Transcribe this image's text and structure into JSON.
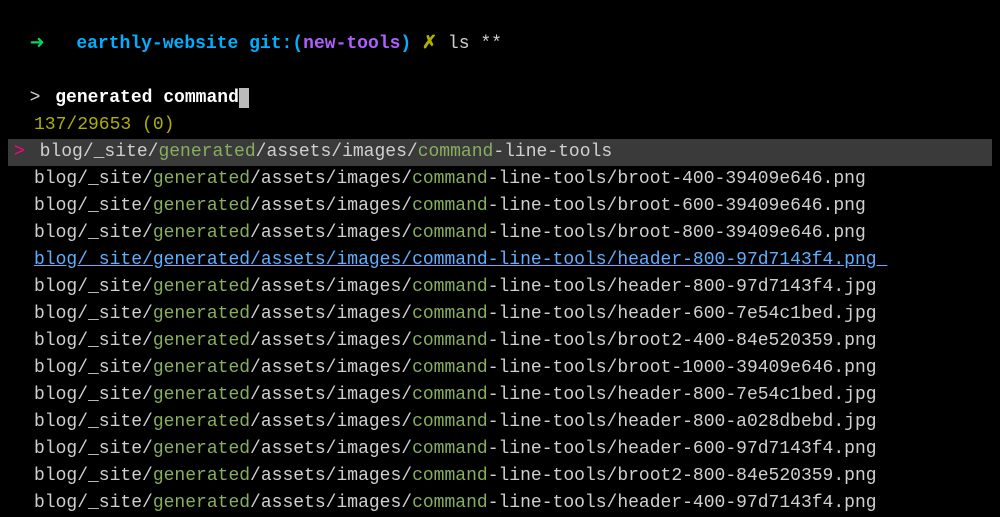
{
  "prompt": {
    "arrow": "➜",
    "dir": "earthly-website",
    "git_label": "git:(",
    "branch": "new-tools",
    "git_close": ")",
    "symbol": "✗",
    "command": "ls **"
  },
  "query": {
    "arrow": ">",
    "text": "generated command"
  },
  "count": "137/29653 (0)",
  "selected_arrow": ">",
  "rows": [
    {
      "selected": true,
      "highlight": false,
      "segments": [
        "blog/_site/",
        "generated",
        "/assets/images/",
        "command",
        "-line-tools"
      ]
    },
    {
      "selected": false,
      "highlight": false,
      "segments": [
        "blog/_site/",
        "generated",
        "/assets/images/",
        "command",
        "-line-tools/broot-400-39409e646.png"
      ]
    },
    {
      "selected": false,
      "highlight": false,
      "segments": [
        "blog/_site/",
        "generated",
        "/assets/images/",
        "command",
        "-line-tools/broot-600-39409e646.png"
      ]
    },
    {
      "selected": false,
      "highlight": false,
      "segments": [
        "blog/_site/",
        "generated",
        "/assets/images/",
        "command",
        "-line-tools/broot-800-39409e646.png"
      ]
    },
    {
      "selected": false,
      "highlight": true,
      "segments": [
        "blog/_site/",
        "generated",
        "/assets/images/",
        "command",
        "-line-tools/header-800-97d7143f4.png"
      ]
    },
    {
      "selected": false,
      "highlight": false,
      "segments": [
        "blog/_site/",
        "generated",
        "/assets/images/",
        "command",
        "-line-tools/header-800-97d7143f4.jpg"
      ]
    },
    {
      "selected": false,
      "highlight": false,
      "segments": [
        "blog/_site/",
        "generated",
        "/assets/images/",
        "command",
        "-line-tools/header-600-7e54c1bed.jpg"
      ]
    },
    {
      "selected": false,
      "highlight": false,
      "segments": [
        "blog/_site/",
        "generated",
        "/assets/images/",
        "command",
        "-line-tools/broot2-400-84e520359.png"
      ]
    },
    {
      "selected": false,
      "highlight": false,
      "segments": [
        "blog/_site/",
        "generated",
        "/assets/images/",
        "command",
        "-line-tools/broot-1000-39409e646.png"
      ]
    },
    {
      "selected": false,
      "highlight": false,
      "segments": [
        "blog/_site/",
        "generated",
        "/assets/images/",
        "command",
        "-line-tools/header-800-7e54c1bed.jpg"
      ]
    },
    {
      "selected": false,
      "highlight": false,
      "segments": [
        "blog/_site/",
        "generated",
        "/assets/images/",
        "command",
        "-line-tools/header-800-a028dbebd.jpg"
      ]
    },
    {
      "selected": false,
      "highlight": false,
      "segments": [
        "blog/_site/",
        "generated",
        "/assets/images/",
        "command",
        "-line-tools/header-600-97d7143f4.png"
      ]
    },
    {
      "selected": false,
      "highlight": false,
      "segments": [
        "blog/_site/",
        "generated",
        "/assets/images/",
        "command",
        "-line-tools/broot2-800-84e520359.png"
      ]
    },
    {
      "selected": false,
      "highlight": false,
      "segments": [
        "blog/_site/",
        "generated",
        "/assets/images/",
        "command",
        "-line-tools/header-400-97d7143f4.png"
      ]
    }
  ]
}
